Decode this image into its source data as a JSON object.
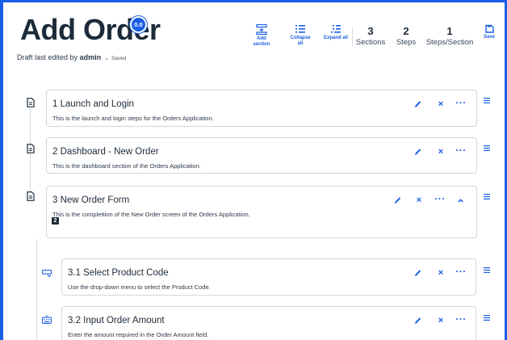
{
  "header": {
    "title": "Add Order",
    "version_badge": "0.0",
    "draft_prefix": "Draft last edited by",
    "editor": "admin",
    "caret": "⌄",
    "saved_label": "Saved"
  },
  "toolbar": {
    "add_section_label": "Add section",
    "collapse_all_label": "Collapse all",
    "expand_all_label": "Expand all",
    "save_label": "Save"
  },
  "stats": {
    "sections_count": "3",
    "sections_label": "Sections",
    "steps_count": "2",
    "steps_label": "Steps",
    "steps_per_section_count": "1",
    "steps_per_section_label": "Steps/Section"
  },
  "sections": [
    {
      "title": "1 Launch and Login",
      "description": "This is the launch and login steps for the Orders Application."
    },
    {
      "title": "2 Dashboard - New Order",
      "description": "This is the dashboard section of the Orders Application."
    },
    {
      "title": "3 New Order Form",
      "description": "This is the complettion of the New Order screen of the Orders Application.",
      "step_count": "2"
    }
  ],
  "steps": [
    {
      "title": "3.1 Select Product Code",
      "description": "Use the drop-down menu to select the Product Code."
    },
    {
      "title": "3.2 Input Order Amount",
      "description": "Enter the amount required in the Order Amount field."
    }
  ],
  "icons": {
    "section": "document-icon",
    "step_select": "dropdown-select-icon",
    "step_input": "keyboard-input-icon",
    "edit": "pencil-icon",
    "delete": "close-icon",
    "more": "more-icon",
    "collapse": "chevron-up-icon",
    "reorder": "drag-handle-icon"
  },
  "colors": {
    "accent": "#1a5ee6",
    "text": "#1c2b39",
    "border": "#d2d7dd"
  }
}
